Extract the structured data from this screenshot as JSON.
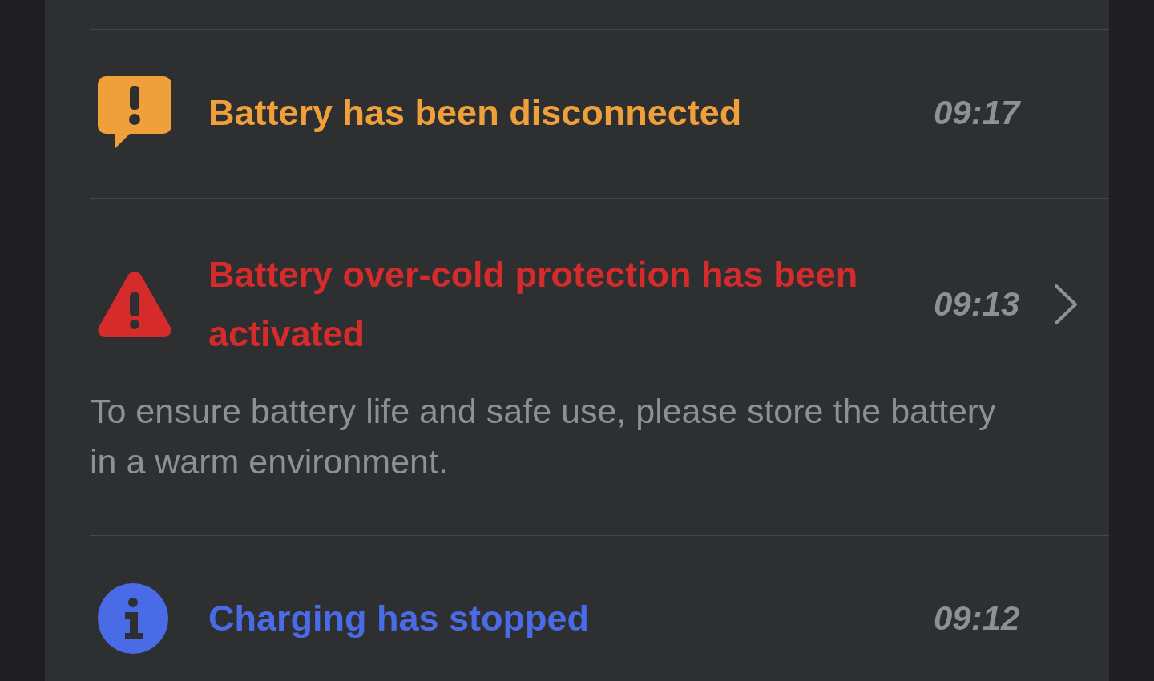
{
  "notifications": [
    {
      "kind": "alert",
      "color": "#f0a03a",
      "title": "Battery has been disconnected",
      "time": "09:17",
      "expandable": false
    },
    {
      "kind": "warning",
      "color": "#d62b2b",
      "title": "Battery over-cold protection has been activated",
      "time": "09:13",
      "expandable": true,
      "description": "To ensure battery life and safe use, please store the battery in a warm environment."
    },
    {
      "kind": "info",
      "color": "#4a6be6",
      "title": "Charging has stopped",
      "time": "09:12",
      "expandable": false
    }
  ]
}
